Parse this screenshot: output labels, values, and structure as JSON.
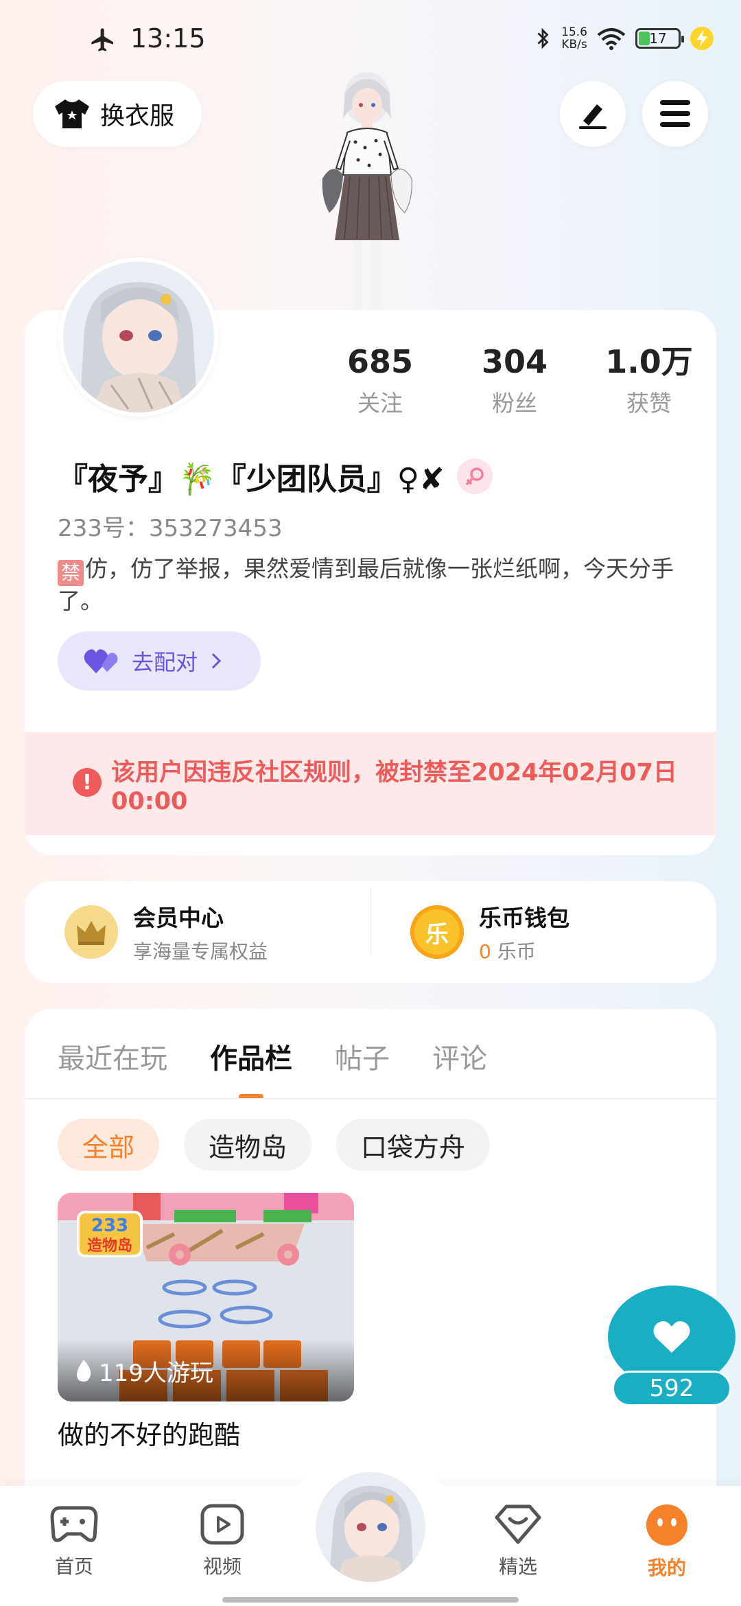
{
  "status_bar": {
    "time": "13:15",
    "net_speed_value": "15.6",
    "net_speed_unit": "KB/s",
    "battery": "17"
  },
  "header": {
    "outfit_label": "换衣服"
  },
  "profile": {
    "stats": [
      {
        "value": "685",
        "label": "关注"
      },
      {
        "value": "304",
        "label": "粉丝"
      },
      {
        "value": "1.0万",
        "label": "获赞"
      }
    ],
    "nickname": "『夜予』🎋『少团队员』♀✘",
    "uid": "233号：353273453",
    "bio_tag": "禁",
    "bio": "仿，仿了举报，果然爱情到最后就像一张烂纸啊，今天分手了。",
    "match_label": "去配对",
    "ban_notice": "该用户因违反社区规则，被封禁至2024年02月07日 00:00"
  },
  "wallet": {
    "member_title": "会员中心",
    "member_sub": "享海量专属权益",
    "wallet_title": "乐币钱包",
    "wallet_icon_char": "乐",
    "wallet_balance": "0",
    "wallet_unit": "乐币"
  },
  "content": {
    "tabs": [
      "最近在玩",
      "作品栏",
      "帖子",
      "评论"
    ],
    "active_tab": "作品栏",
    "chips": [
      "全部",
      "造物岛",
      "口袋方舟"
    ],
    "game": {
      "badge_top": "233",
      "badge_bottom": "造物岛",
      "plays": "119人游玩",
      "title": "做的不好的跑酷"
    }
  },
  "float_like": {
    "count": "592"
  },
  "bottom_nav": [
    {
      "label": "首页",
      "icon": "gamepad-icon"
    },
    {
      "label": "视频",
      "icon": "video-icon"
    },
    {
      "label": "精选",
      "icon": "featured-icon"
    },
    {
      "label": "我的",
      "icon": "profile-face-icon"
    }
  ],
  "colors": {
    "accent": "#f5822a",
    "ban": "#ec5a5a",
    "match": "#6654d8",
    "like": "#1aaec4"
  }
}
